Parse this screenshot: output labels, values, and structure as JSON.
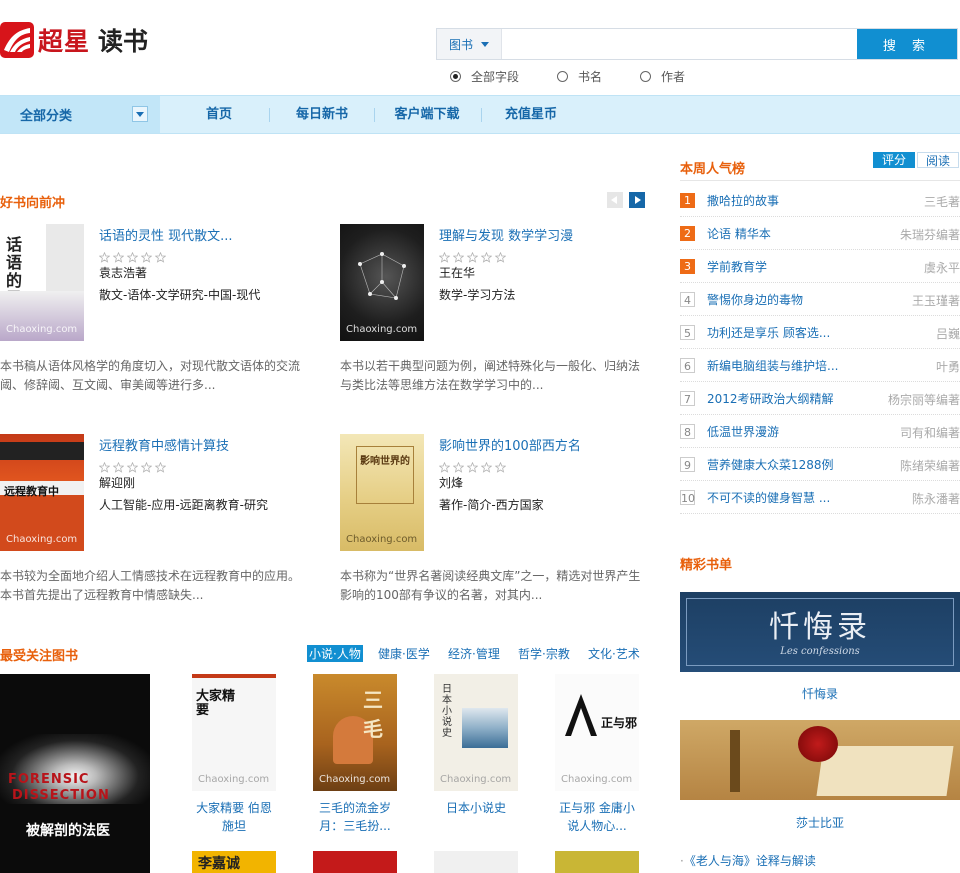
{
  "header": {
    "logo_cn": "超星",
    "logo_sub": "读书",
    "search_type": "图书",
    "search_value": "",
    "search_button": "搜 索",
    "search_options": [
      "全部字段",
      "书名",
      "作者"
    ]
  },
  "nav": {
    "all": "全部分类",
    "items": [
      "首页",
      "每日新书",
      "客户端下载",
      "充值星币"
    ]
  },
  "featured": {
    "title": "好书向前冲",
    "books": [
      {
        "title": "话语的灵性 现代散文...",
        "author": "袁志浩著",
        "category": "散文-语体-文学研究-中国-现代",
        "desc": "本书稿从语体风格学的角度切入，对现代散文语体的交流阈、修辞阈、互文阈、审美阈等进行多...",
        "cover_text": "话语的灵性"
      },
      {
        "title": "理解与发现 数学学习漫",
        "author": "王在华",
        "category": "数学-学习方法",
        "desc": "本书以若干典型问题为例，阐述特殊化与一般化、归纳法与类比法等思维方法在数学学习中的...",
        "cover_text": ""
      },
      {
        "title": "远程教育中感情计算技",
        "author": "解迎刚",
        "category": "人工智能-应用-远距离教育-研究",
        "desc": "本书较为全面地介绍人工情感技术在远程教育中的应用。本书首先提出了远程教育中情感缺失...",
        "cover_text": "远程教育中"
      },
      {
        "title": "影响世界的100部西方名",
        "author": "刘烽",
        "category": "著作-简介-西方国家",
        "desc": "本书称为“世界名著阅读经典文库”之一，精选对世界产生影响的100部有争议的名著，对其内...",
        "cover_text": "影响世界的"
      }
    ],
    "watermark": "Chaoxing.com"
  },
  "popular": {
    "title": "最受关注图书",
    "tabs": [
      "小说·人物",
      "健康·医学",
      "经济·管理",
      "哲学·宗教",
      "文化·艺术"
    ],
    "big_cover_text": [
      "FORENSIC",
      "DISSECTION",
      "被解剖的法医"
    ],
    "books": [
      {
        "line1": "大家精要 伯恩",
        "line2": "施坦",
        "cover_text": "大家精要"
      },
      {
        "line1": "三毛的流金岁",
        "line2": "月：三毛扮...",
        "cover_text": "三毛"
      },
      {
        "line1": "日本小说史",
        "line2": "",
        "cover_text": "日本小说史"
      },
      {
        "line1": "正与邪 金庸小",
        "line2": "说人物心...",
        "cover_text": "正与邪"
      }
    ],
    "bottom_cover_text": "李嘉诚"
  },
  "ranking": {
    "title": "本周人气榜",
    "tabs": [
      "评分",
      "阅读"
    ],
    "items": [
      {
        "num": "1",
        "title": "撒哈拉的故事",
        "author": "三毛著"
      },
      {
        "num": "2",
        "title": "论语 精华本",
        "author": "朱瑞芬编著"
      },
      {
        "num": "3",
        "title": "学前教育学",
        "author": "虞永平"
      },
      {
        "num": "4",
        "title": "警惕你身边的毒物",
        "author": "王玉瑾著"
      },
      {
        "num": "5",
        "title": "功利还是享乐 顾客选...",
        "author": "吕巍"
      },
      {
        "num": "6",
        "title": "新编电脑组装与维护培...",
        "author": "叶勇"
      },
      {
        "num": "7",
        "title": "2012考研政治大纲精解",
        "author": "杨宗丽等编著"
      },
      {
        "num": "8",
        "title": "低温世界漫游",
        "author": "司有和编著"
      },
      {
        "num": "9",
        "title": "营养健康大众菜1288例",
        "author": "陈绪荣编著"
      },
      {
        "num": "10",
        "title": "不可不读的健身智慧 ...",
        "author": "陈永潘著"
      }
    ]
  },
  "booklists": {
    "title": "精彩书单",
    "items": [
      {
        "caption": "忏悔录",
        "banner_text": "忏悔录",
        "banner_sub": "Les confessions"
      },
      {
        "caption": "莎士比亚"
      }
    ],
    "link": "《老人与海》诠释与解读"
  }
}
